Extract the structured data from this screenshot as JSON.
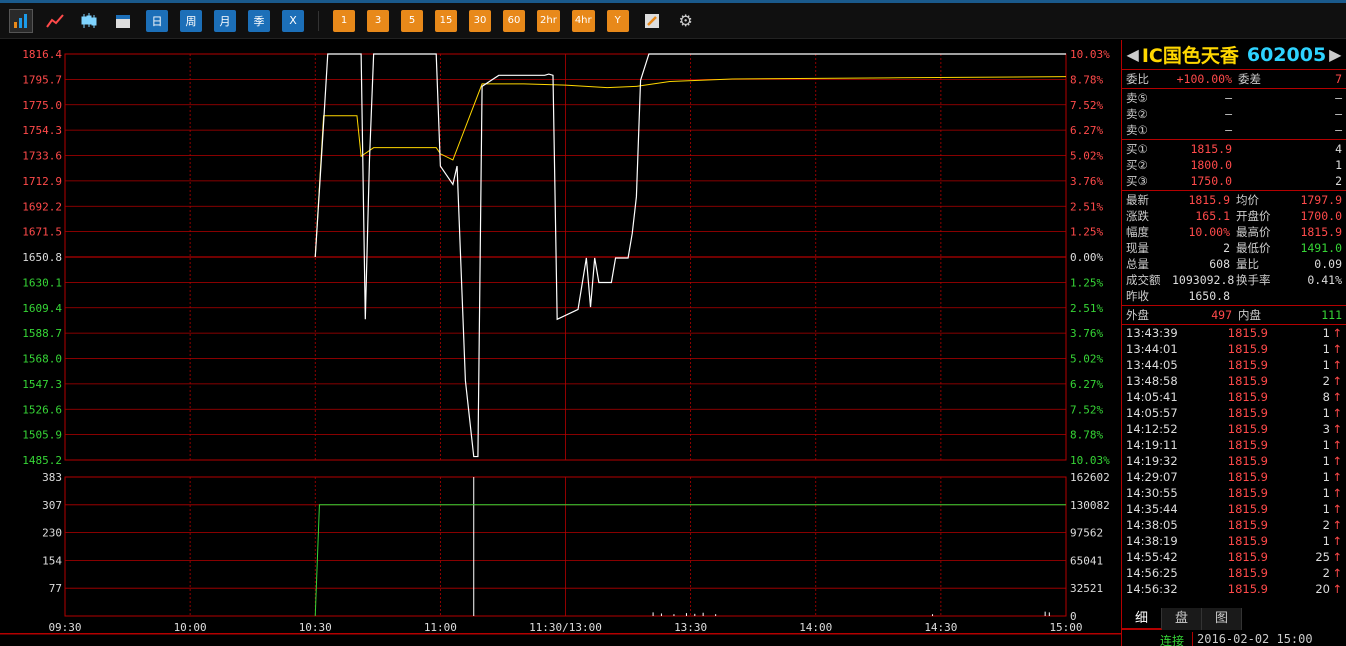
{
  "toolbar": {
    "periods": [
      "日",
      "周",
      "月",
      "季",
      "X"
    ],
    "minutes": [
      "1",
      "3",
      "5",
      "15",
      "30",
      "60",
      "2hr",
      "4hr",
      "Y"
    ]
  },
  "chart_data": {
    "type": "line",
    "price_axis": [
      "1816.4",
      "1795.7",
      "1775.0",
      "1754.3",
      "1733.6",
      "1712.9",
      "1692.2",
      "1671.5",
      "1650.8",
      "1630.1",
      "1609.4",
      "1588.7",
      "1568.0",
      "1547.3",
      "1526.6",
      "1505.9",
      "1485.2"
    ],
    "pct_axis": [
      "10.03%",
      "8.78%",
      "7.52%",
      "6.27%",
      "5.02%",
      "3.76%",
      "2.51%",
      "1.25%",
      "0.00%",
      "1.25%",
      "2.51%",
      "3.76%",
      "5.02%",
      "6.27%",
      "7.52%",
      "8.78%",
      "10.03%"
    ],
    "vol_axis": [
      "383",
      "307",
      "230",
      "154",
      "77"
    ],
    "amt_axis": [
      "162602",
      "130082",
      "97562",
      "65041",
      "32521",
      "0"
    ],
    "time_axis": [
      "09:30",
      "10:00",
      "10:30",
      "11:00",
      "11:30/13:00",
      "13:30",
      "14:00",
      "14:30",
      "15:00"
    ],
    "ylim": [
      1485.2,
      1816.4
    ],
    "prev_close": 1650.8,
    "price_series": [
      [
        60,
        1650.8
      ],
      [
        62,
        1760
      ],
      [
        63,
        1816.4
      ],
      [
        71,
        1816.4
      ],
      [
        72,
        1600
      ],
      [
        73,
        1730
      ],
      [
        74,
        1816.4
      ],
      [
        89,
        1816.4
      ],
      [
        90,
        1725
      ],
      [
        93,
        1710
      ],
      [
        94,
        1725
      ],
      [
        96,
        1550
      ],
      [
        98,
        1488
      ],
      [
        99,
        1488
      ],
      [
        100,
        1790
      ],
      [
        104,
        1799
      ],
      [
        110,
        1799
      ],
      [
        115,
        1799
      ],
      [
        116,
        1800
      ],
      [
        117,
        1799
      ],
      [
        118,
        1600
      ],
      [
        123,
        1608
      ],
      [
        125,
        1650
      ],
      [
        126,
        1610
      ],
      [
        127,
        1650
      ],
      [
        128,
        1630
      ],
      [
        131,
        1630
      ],
      [
        132,
        1650
      ],
      [
        135,
        1650
      ],
      [
        136,
        1670
      ],
      [
        137,
        1700
      ],
      [
        138,
        1795
      ],
      [
        140,
        1816.4
      ],
      [
        240,
        1816.4
      ]
    ],
    "avg_series": [
      [
        60,
        1650.8
      ],
      [
        62,
        1766
      ],
      [
        66,
        1766
      ],
      [
        70,
        1766
      ],
      [
        71,
        1733
      ],
      [
        74,
        1740
      ],
      [
        89,
        1740
      ],
      [
        90,
        1735
      ],
      [
        93,
        1730
      ],
      [
        100,
        1792
      ],
      [
        110,
        1792
      ],
      [
        120,
        1791
      ],
      [
        130,
        1789
      ],
      [
        137,
        1790
      ],
      [
        145,
        1794
      ],
      [
        160,
        1796
      ],
      [
        200,
        1797
      ],
      [
        240,
        1797.9
      ]
    ],
    "amt_series": [
      [
        60,
        0
      ],
      [
        61,
        130082
      ],
      [
        240,
        130082
      ]
    ]
  },
  "quote": {
    "name": "IC国色天香",
    "code": "602005",
    "wb_label": "委比",
    "wb": "+100.00%",
    "wc_label": "委差",
    "wc": "7",
    "asks": [
      {
        "l": "卖⑤",
        "p": "—",
        "v": "—"
      },
      {
        "l": "卖②",
        "p": "—",
        "v": "—"
      },
      {
        "l": "卖①",
        "p": "—",
        "v": "—"
      }
    ],
    "bids": [
      {
        "l": "买①",
        "p": "1815.9",
        "v": "4"
      },
      {
        "l": "买②",
        "p": "1800.0",
        "v": "1"
      },
      {
        "l": "买③",
        "p": "1750.0",
        "v": "2"
      }
    ],
    "stats": [
      {
        "l": "最新",
        "v": "1815.9",
        "c": "red",
        "l2": "均价",
        "v2": "1797.9",
        "c2": "red"
      },
      {
        "l": "涨跌",
        "v": "165.1",
        "c": "red",
        "l2": "开盘价",
        "v2": "1700.0",
        "c2": "red"
      },
      {
        "l": "幅度",
        "v": "10.00%",
        "c": "red",
        "l2": "最高价",
        "v2": "1815.9",
        "c2": "red"
      },
      {
        "l": "现量",
        "v": "2",
        "c": "wht",
        "l2": "最低价",
        "v2": "1491.0",
        "c2": "grn"
      },
      {
        "l": "总量",
        "v": "608",
        "c": "wht",
        "l2": "量比",
        "v2": "0.09",
        "c2": "wht"
      },
      {
        "l": "成交额",
        "v": "1093092.8",
        "c": "wht",
        "l2": "换手率",
        "v2": "0.41%",
        "c2": "wht"
      },
      {
        "l": "昨收",
        "v": "1650.8",
        "c": "wht",
        "l2": "",
        "v2": "",
        "c2": "wht"
      }
    ],
    "outer_label": "外盘",
    "outer": "497",
    "inner_label": "内盘",
    "inner": "111"
  },
  "ticks": [
    {
      "t": "13:43:39",
      "p": "1815.9",
      "q": "1"
    },
    {
      "t": "13:44:01",
      "p": "1815.9",
      "q": "1"
    },
    {
      "t": "13:44:05",
      "p": "1815.9",
      "q": "1"
    },
    {
      "t": "13:48:58",
      "p": "1815.9",
      "q": "2"
    },
    {
      "t": "14:05:41",
      "p": "1815.9",
      "q": "8"
    },
    {
      "t": "14:05:57",
      "p": "1815.9",
      "q": "1"
    },
    {
      "t": "14:12:52",
      "p": "1815.9",
      "q": "3"
    },
    {
      "t": "14:19:11",
      "p": "1815.9",
      "q": "1"
    },
    {
      "t": "14:19:32",
      "p": "1815.9",
      "q": "1"
    },
    {
      "t": "14:29:07",
      "p": "1815.9",
      "q": "1"
    },
    {
      "t": "14:30:55",
      "p": "1815.9",
      "q": "1"
    },
    {
      "t": "14:35:44",
      "p": "1815.9",
      "q": "1"
    },
    {
      "t": "14:38:05",
      "p": "1815.9",
      "q": "2"
    },
    {
      "t": "14:38:19",
      "p": "1815.9",
      "q": "1"
    },
    {
      "t": "14:55:42",
      "p": "1815.9",
      "q": "25"
    },
    {
      "t": "14:56:25",
      "p": "1815.9",
      "q": "2"
    },
    {
      "t": "14:56:32",
      "p": "1815.9",
      "q": "20"
    }
  ],
  "tabs": [
    "细",
    "盘",
    "图"
  ],
  "status": {
    "conn": "连接",
    "date": "2016-02-02 15:00"
  }
}
